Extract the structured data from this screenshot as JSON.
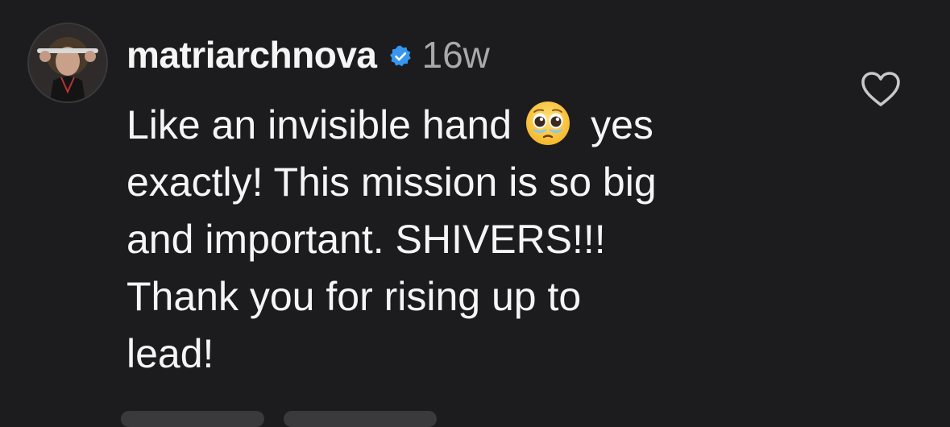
{
  "comment": {
    "username": "matriarchnova",
    "verified": true,
    "timestamp": "16w",
    "body_lines": {
      "line1_before": "Like an invisible hand",
      "line1_emoji": "pleading-face-with-tears",
      "line1_after": "yes",
      "line2": "exactly! This mission is so big",
      "line3": "and important. SHIVERS!!!",
      "line4": "Thank you for rising up to",
      "line5": "lead!"
    }
  },
  "icons": {
    "avatar": "profile-photo",
    "verified": "verified-badge-icon",
    "like": "heart-outline-icon"
  },
  "colors": {
    "background": "#1c1c1e",
    "text": "#f5f5f5",
    "muted": "#a8a8ad",
    "verified": "#3797f0"
  }
}
